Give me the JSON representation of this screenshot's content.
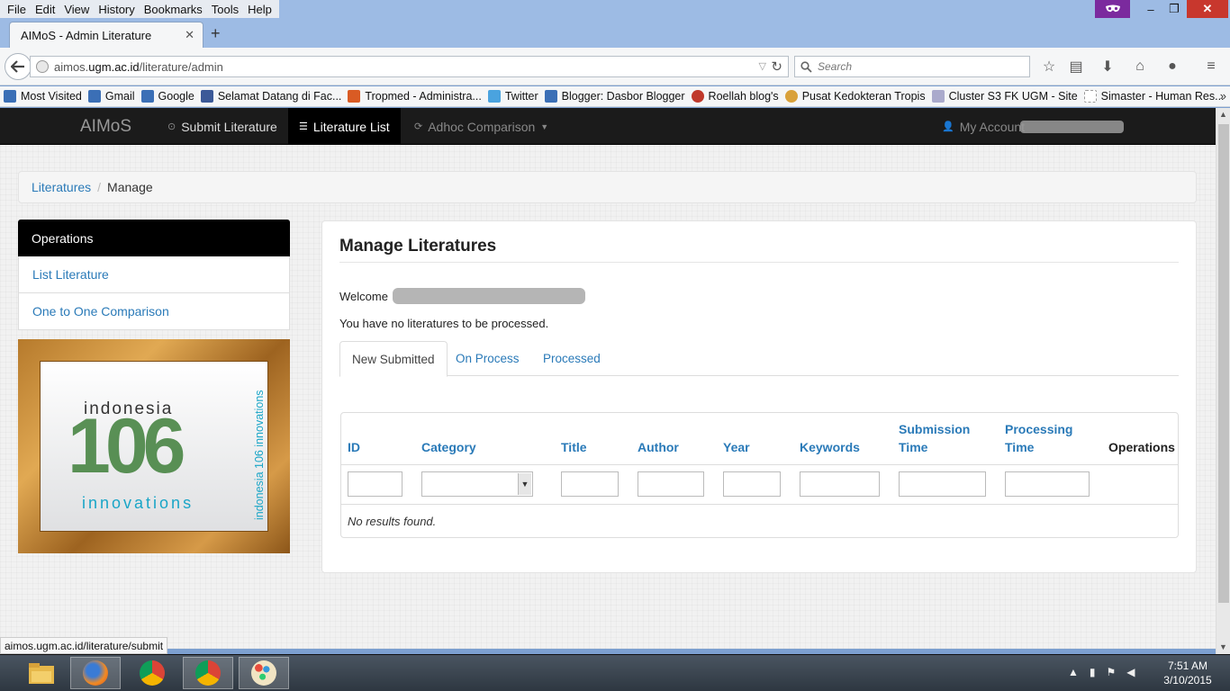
{
  "menubar": {
    "items": [
      "File",
      "Edit",
      "View",
      "History",
      "Bookmarks",
      "Tools",
      "Help"
    ]
  },
  "window": {
    "min": "–",
    "max": "❐",
    "close": "✕"
  },
  "tab": {
    "title": "AIMoS - Admin Literature",
    "close": "✕",
    "new": "+"
  },
  "urlbar": {
    "prefix": "aimos.",
    "domain": "ugm.ac.id",
    "path": "/literature/admin"
  },
  "searchbar": {
    "placeholder": "Search"
  },
  "bookmarks": [
    {
      "label": "Most Visited",
      "color": "#3b6fb6"
    },
    {
      "label": "Gmail",
      "color": "#3b6fb6"
    },
    {
      "label": "Google",
      "color": "#3b6fb6"
    },
    {
      "label": "Selamat Datang di Fac...",
      "color": "#3b5998"
    },
    {
      "label": "Tropmed - Administra...",
      "color": "#d95b24"
    },
    {
      "label": "Twitter",
      "color": "#4aa3df"
    },
    {
      "label": "Blogger: Dasbor Blogger",
      "color": "#3b6fb6"
    },
    {
      "label": "Roellah blog's",
      "color": "#c0392b"
    },
    {
      "label": "Pusat Kedokteran Tropis",
      "color": "#d9a13a"
    },
    {
      "label": "Cluster S3 FK UGM - Site",
      "color": "#8aa"
    },
    {
      "label": "Simaster - Human Res...",
      "color": "#ccc"
    }
  ],
  "app": {
    "brand": "AIMoS",
    "nav": {
      "submit": "Submit Literature",
      "list": "Literature List",
      "adhoc": "Adhoc Comparison",
      "account": "My Account"
    }
  },
  "breadcrumb": {
    "link": "Literatures",
    "sep": "/",
    "current": "Manage"
  },
  "sidebar": {
    "heading": "Operations",
    "items": [
      "List Literature",
      "One to One Comparison"
    ]
  },
  "logo": {
    "top": "indonesia",
    "num": "106",
    "bottom": "innovations",
    "vertical": "indonesia 106 innovations"
  },
  "main": {
    "title": "Manage Literatures",
    "welcome": "Welcome",
    "message": "You have no literatures to be processed.",
    "tabs": [
      "New Submitted",
      "On Process",
      "Processed"
    ],
    "columns": [
      "ID",
      "Category",
      "Title",
      "Author",
      "Year",
      "Keywords",
      "Submission Time",
      "Processing Time",
      "Operations"
    ],
    "empty": "No results found."
  },
  "statusbar": "aimos.ugm.ac.id/literature/submit",
  "clock": {
    "time": "7:51 AM",
    "date": "3/10/2015"
  }
}
